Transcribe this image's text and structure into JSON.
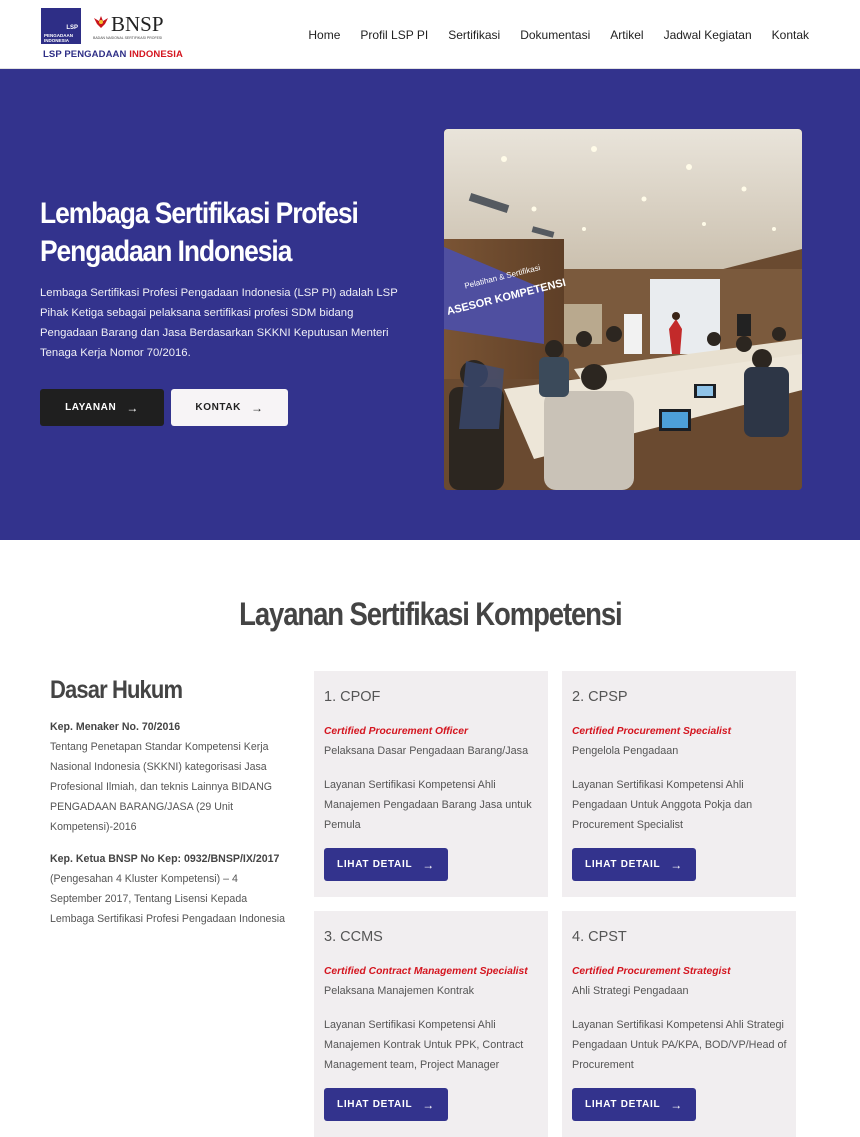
{
  "header": {
    "logo_lsp_top": "LSP",
    "logo_lsp_line1": "PENGADAAN",
    "logo_lsp_line2": "INDONESIA",
    "logo_bnsp": "BNSP",
    "logo_bnsp_sub": "BADAN NASIONAL SERTIFIKASI PROFESI",
    "logo_caption_blue": "LSP PENGADAAN",
    "logo_caption_red": "INDONESIA",
    "nav": [
      "Home",
      "Profil LSP PI",
      "Sertifikasi",
      "Dokumentasi",
      "Artikel",
      "Jadwal Kegiatan",
      "Kontak"
    ]
  },
  "hero": {
    "title": "Lembaga Sertifikasi Profesi Pengadaan Indonesia",
    "description": "Lembaga Sertifikasi Profesi Pengadaan Indonesia (LSP PI) adalah LSP Pihak Ketiga sebagai pelaksana sertifikasi profesi SDM bidang Pengadaan Barang dan Jasa Berdasarkan SKKNI Keputusan Menteri Tenaga Kerja Nomor 70/2016.",
    "btn_primary": "LAYANAN",
    "btn_secondary": "KONTAK",
    "photo_banner_line1": "Pelatihan & Sertifikasi",
    "photo_banner_line2": "ASESOR KOMPETENSI"
  },
  "services": {
    "title": "Layanan Sertifikasi Kompetensi",
    "dasar": {
      "title": "Dasar Hukum",
      "items": [
        {
          "head": "Kep. Menaker No. 70/2016",
          "body": "Tentang Penetapan Standar Kompetensi Kerja Nasional Indonesia (SKKNI) kategorisasi Jasa Profesional Ilmiah, dan teknis Lainnya BIDANG PENGADAAN BARANG/JASA (29 Unit Kompetensi)-2016"
        },
        {
          "head": "Kep. Ketua BNSP No Kep: 0932/BNSP/IX/2017",
          "body": "(Pengesahan 4 Kluster Kompetensi) – 4 September 2017, Tentang Lisensi Kepada Lembaga Sertifikasi Profesi Pengadaan Indonesia"
        }
      ]
    },
    "cards": [
      {
        "title": "1. CPOF",
        "subtitle": "Certified Procurement Officer",
        "role": "Pelaksana Dasar Pengadaan Barang/Jasa",
        "desc": "Layanan Sertifikasi Kompetensi Ahli Manajemen Pengadaan Barang Jasa untuk Pemula",
        "btn": "LIHAT DETAIL"
      },
      {
        "title": "2. CPSP",
        "subtitle": "Certified Procurement Specialist",
        "role": "Pengelola Pengadaan",
        "desc": "Layanan Sertifikasi Kompetensi Ahli Pengadaan Untuk Anggota Pokja dan Procurement Specialist",
        "btn": "LIHAT DETAIL"
      },
      {
        "title": "3. CCMS",
        "subtitle": "Certified Contract Management Specialist",
        "role": "Pelaksana Manajemen Kontrak",
        "desc": "Layanan Sertifikasi Kompetensi Ahli Manajemen Kontrak Untuk PPK, Contract Management team, Project Manager",
        "btn": "LIHAT DETAIL"
      },
      {
        "title": "4. CPST",
        "subtitle": "Certified Procurement Strategist",
        "role": "Ahli Strategi Pengadaan",
        "desc": "Layanan Sertifikasi Kompetensi Ahli Strategi Pengadaan Untuk PA/KPA, BOD/VP/Head of Procurement",
        "btn": "LIHAT DETAIL"
      }
    ]
  },
  "colors": {
    "brand_blue": "#33338d",
    "accent_red": "#d4151f",
    "card_bg": "#f1eef0"
  }
}
